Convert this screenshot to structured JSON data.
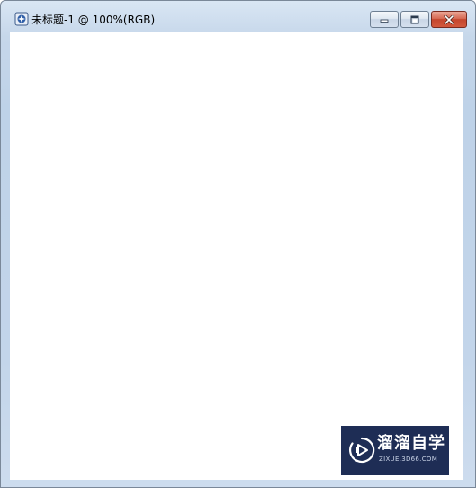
{
  "window": {
    "title": "未标题-1 @ 100%(RGB)",
    "app_icon": "photoshop-document-icon",
    "controls": {
      "minimize": "minimize-icon",
      "maximize": "maximize-icon",
      "close": "close-icon"
    }
  },
  "canvas": {
    "background": "#ffffff"
  },
  "watermark": {
    "name": "溜溜自学",
    "url": "ZIXUE.3D66.COM",
    "background": "#1e2d55",
    "icon": "play-logo-icon"
  }
}
